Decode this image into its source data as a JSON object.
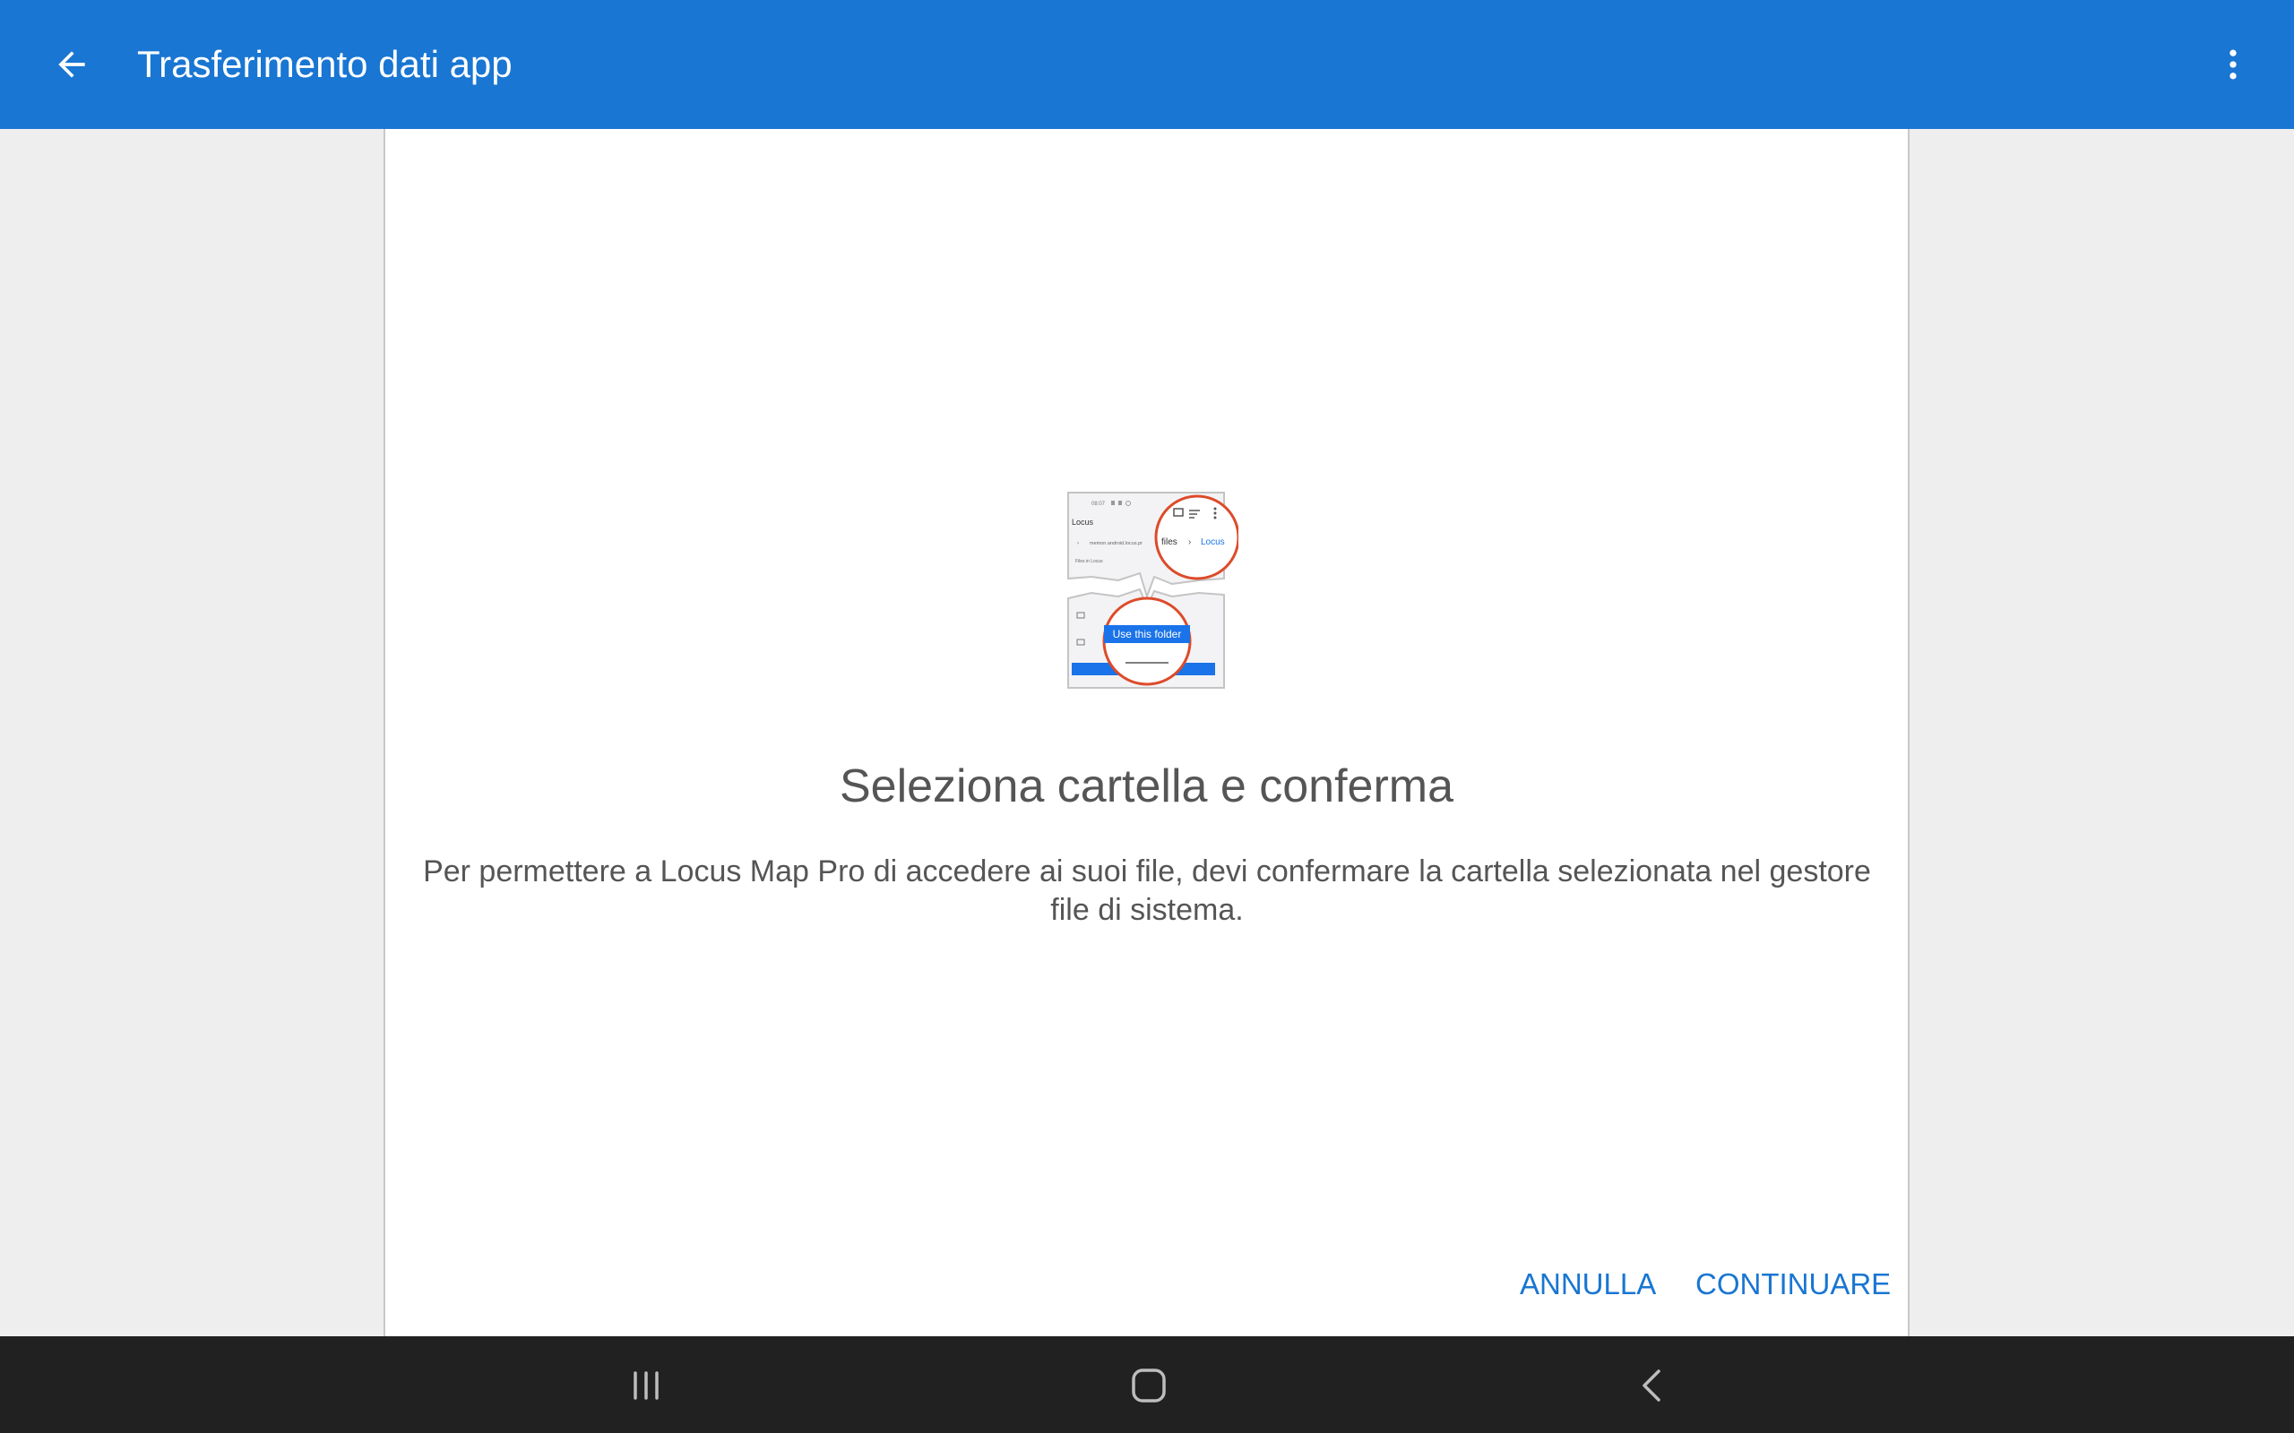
{
  "appbar": {
    "title": "Trasferimento dati app",
    "background": "#1976d2",
    "back_icon": "arrow-back-icon",
    "menu_icon": "more-vert-icon"
  },
  "illustration": {
    "time": "08:07",
    "folder_title": "Locus",
    "path_text": "memon.android.locus.pr",
    "list_header": "Files in Locus",
    "crumb_parent": "files",
    "crumb_current": "Locus",
    "folder_button": "Use this folder",
    "highlight_color": "#dd4b2a"
  },
  "content": {
    "heading": "Seleziona cartella e conferma",
    "description": "Per permettere a Locus Map Pro di accedere ai suoi file, devi confermare la cartella selezionata nel gestore file di sistema."
  },
  "actions": {
    "cancel_label": "ANNULLA",
    "continue_label": "CONTINUARE",
    "accent": "#1976d2"
  },
  "navbar": {
    "recents_icon": "recent-apps-icon",
    "home_icon": "home-icon",
    "back_icon": "nav-back-icon"
  }
}
